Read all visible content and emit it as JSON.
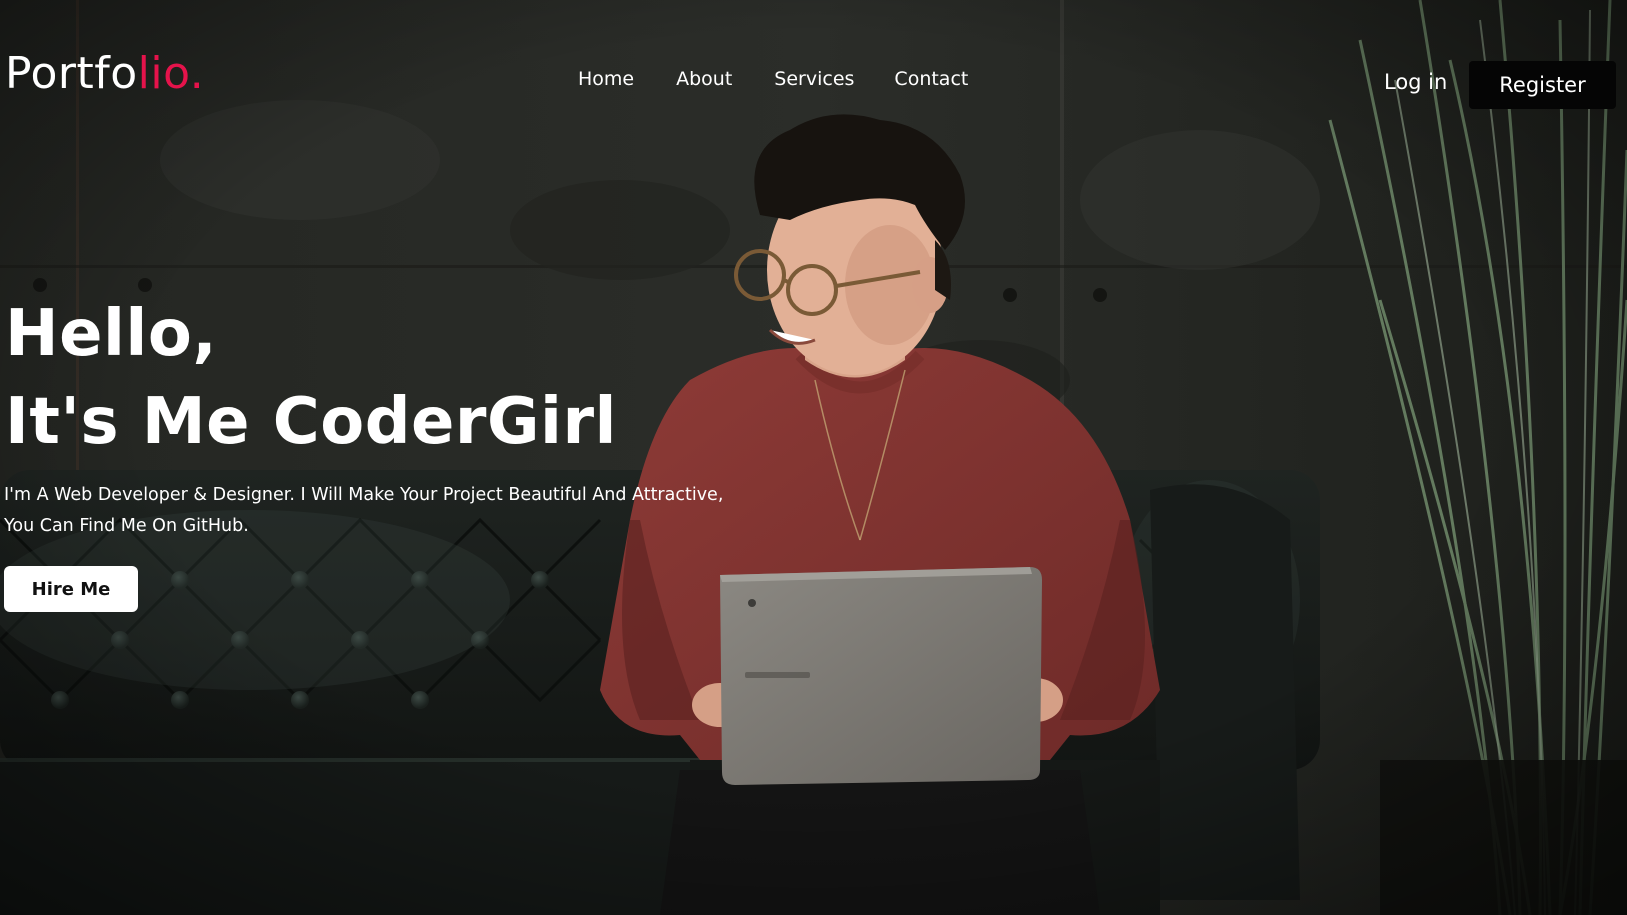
{
  "header": {
    "logo_main": "Portfo",
    "logo_accent": "lio.",
    "nav": {
      "home": "Home",
      "about": "About",
      "services": "Services",
      "contact": "Contact"
    },
    "login": "Log in",
    "register": "Register"
  },
  "hero": {
    "title_line1": "Hello,",
    "title_line2": "It's Me CoderGirl",
    "desc_line1": "I'm A Web Developer & Designer. I Will Make Your Project Beautiful And Attractive,",
    "desc_line2": "You Can Find Me On GitHub.",
    "cta": "Hire Me"
  },
  "colors": {
    "accent": "#e5134b",
    "button_dark": "#050505",
    "button_light": "#ffffff"
  }
}
